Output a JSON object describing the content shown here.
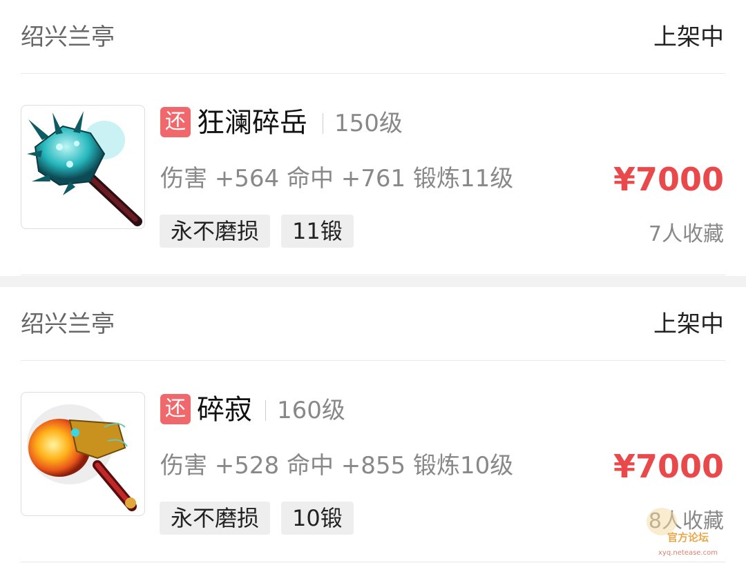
{
  "colors": {
    "price": "#e9494b",
    "tag_return_bg": "#f0686c",
    "chip_bg": "#eeeeee",
    "divider": "#f2f2f2"
  },
  "listings": [
    {
      "server": "绍兴兰亭",
      "status": "上架中",
      "tag": "还",
      "name": "狂澜碎岳",
      "level": "150级",
      "stats": "伤害 +564 命中 +761 锻炼11级",
      "price": "¥7000",
      "chips": [
        "永不磨损",
        "11锻"
      ],
      "favorites": "7人收藏",
      "icon": "cyan-spiked-mace-icon"
    },
    {
      "server": "绍兴兰亭",
      "status": "上架中",
      "tag": "还",
      "name": "碎寂",
      "level": "160级",
      "stats": "伤害 +528 命中 +855 锻炼10级",
      "price": "¥7000",
      "chips": [
        "永不磨损",
        "10锻"
      ],
      "favorites": "8人收藏",
      "icon": "golden-dragon-hammer-icon"
    }
  ],
  "watermark": {
    "line1": "官方论坛",
    "line2": "xyq.netease.com"
  }
}
